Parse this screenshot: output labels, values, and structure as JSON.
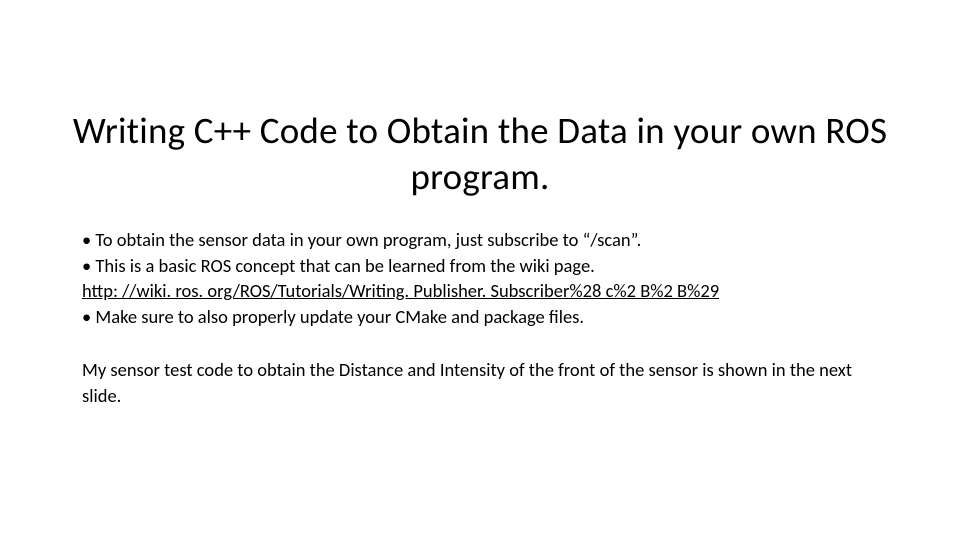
{
  "title": "Writing C++ Code to Obtain the Data in your own ROS program.",
  "bullets": {
    "b1": "To obtain the sensor data in your own program, just subscribe to “/scan”.",
    "b2": "This is a basic ROS concept that can be learned from the wiki page.",
    "b3": "Make sure to also properly update your CMake and package files."
  },
  "link": "http: //wiki. ros. org/ROS/Tutorials/Writing. Publisher. Subscriber%28 c%2 B%2 B%29",
  "closing": "My sensor test code to obtain the Distance and Intensity of the front of the sensor is shown in the next slide."
}
